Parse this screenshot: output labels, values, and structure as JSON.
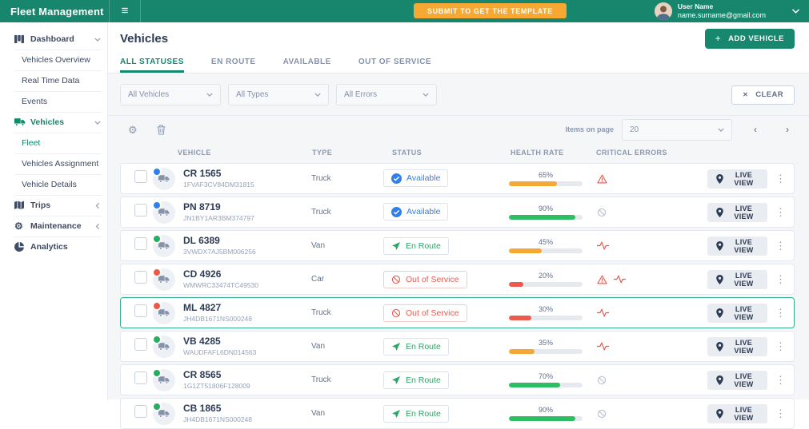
{
  "header": {
    "brand": "Fleet Management",
    "submit_button_label": "SUBMIT TO GET THE TEMPLATE",
    "user_name": "User Name",
    "user_email": "name.surname@gmail.com"
  },
  "sidebar": {
    "items": [
      {
        "label": "Dashboard",
        "icon": "dashboard",
        "chevron": "down",
        "level": "parent",
        "active": false
      },
      {
        "label": "Vehicles Overview",
        "level": "child",
        "active": false
      },
      {
        "label": "Real Time Data",
        "level": "child",
        "active": false
      },
      {
        "label": "Events",
        "level": "child",
        "active": false
      },
      {
        "label": "Vehicles",
        "icon": "truck",
        "chevron": "down",
        "level": "parent",
        "active": true
      },
      {
        "label": "Fleet",
        "level": "child",
        "active": true
      },
      {
        "label": "Vehicles Assignment",
        "level": "child",
        "active": false
      },
      {
        "label": "Vehicle Details",
        "level": "child",
        "active": false
      },
      {
        "label": "Trips",
        "icon": "trips",
        "chevron": "left",
        "level": "parent",
        "active": false
      },
      {
        "label": "Maintenance",
        "icon": "gear",
        "chevron": "left",
        "level": "parent",
        "active": false
      },
      {
        "label": "Analytics",
        "icon": "pie-chart",
        "level": "parent",
        "active": false
      }
    ]
  },
  "page": {
    "title": "Vehicles",
    "add_vehicle_button": "ADD VEHICLE",
    "tabs": [
      {
        "label": "ALL STATUSES",
        "active": true
      },
      {
        "label": "EN ROUTE",
        "active": false
      },
      {
        "label": "AVAILABLE",
        "active": false
      },
      {
        "label": "OUT OF SERVICE",
        "active": false
      }
    ],
    "filters": [
      {
        "value": "All Vehicles"
      },
      {
        "value": "All Types"
      },
      {
        "value": "All Errors"
      }
    ],
    "clear_button": "CLEAR",
    "pagination": {
      "items_on_page_label": "Items on page",
      "items_on_page_value": "20"
    },
    "table": {
      "columns": [
        "VEHICLE",
        "TYPE",
        "STATUS",
        "HEALTH RATE",
        "CRITICAL ERRORS"
      ],
      "live_view_label": "LIVE VIEW",
      "rows": [
        {
          "name": "CR 1565",
          "vin": "1FVAF3CV84DM31815",
          "type": "Truck",
          "status": "Available",
          "status_key": "available",
          "health": 65,
          "health_label": "65%",
          "health_color": "orange",
          "errors": [
            "warning"
          ],
          "dot": "blue",
          "selected": false
        },
        {
          "name": "PN 8719",
          "vin": "JN1BY1AR3BM374797",
          "type": "Truck",
          "status": "Available",
          "status_key": "available",
          "health": 90,
          "health_label": "90%",
          "health_color": "green",
          "errors": [
            "none"
          ],
          "dot": "blue",
          "selected": false
        },
        {
          "name": "DL 6389",
          "vin": "3VWDX7AJ5BM006256",
          "type": "Van",
          "status": "En Route",
          "status_key": "en_route",
          "health": 45,
          "health_label": "45%",
          "health_color": "orange",
          "errors": [
            "pulse"
          ],
          "dot": "green",
          "selected": false
        },
        {
          "name": "CD 4926",
          "vin": "WMWRC33474TC49530",
          "type": "Car",
          "status": "Out of Service",
          "status_key": "out_of_service",
          "health": 20,
          "health_label": "20%",
          "health_color": "red",
          "errors": [
            "warning",
            "pulse"
          ],
          "dot": "red",
          "selected": false
        },
        {
          "name": "ML 4827",
          "vin": "JH4DB1671NS000248",
          "type": "Truck",
          "status": "Out of Service",
          "status_key": "out_of_service",
          "health": 30,
          "health_label": "30%",
          "health_color": "red",
          "errors": [
            "pulse"
          ],
          "dot": "red",
          "selected": true
        },
        {
          "name": "VB 4285",
          "vin": "WAUDFAFL6DN014563",
          "type": "Van",
          "status": "En Route",
          "status_key": "en_route",
          "health": 35,
          "health_label": "35%",
          "health_color": "orange",
          "errors": [
            "pulse"
          ],
          "dot": "green",
          "selected": false
        },
        {
          "name": "CR 8565",
          "vin": "1G1ZT51806F128009",
          "type": "Truck",
          "status": "En Route",
          "status_key": "en_route",
          "health": 70,
          "health_label": "70%",
          "health_color": "green",
          "errors": [
            "none"
          ],
          "dot": "green",
          "selected": false
        },
        {
          "name": "CB 1865",
          "vin": "JH4DB1671NS000248",
          "type": "Van",
          "status": "En Route",
          "status_key": "en_route",
          "health": 90,
          "health_label": "90%",
          "health_color": "green",
          "errors": [
            "none"
          ],
          "dot": "green",
          "selected": false
        }
      ]
    }
  },
  "colors": {
    "header_teal": "#18866C",
    "accent_orange": "#F7A832",
    "status_available": "#2F80ED",
    "status_en_route": "#27A865",
    "status_out_of_service": "#EA5A4F",
    "health_green": "#2DBE64",
    "health_orange": "#F5A836",
    "health_red": "#EA5A4F"
  }
}
